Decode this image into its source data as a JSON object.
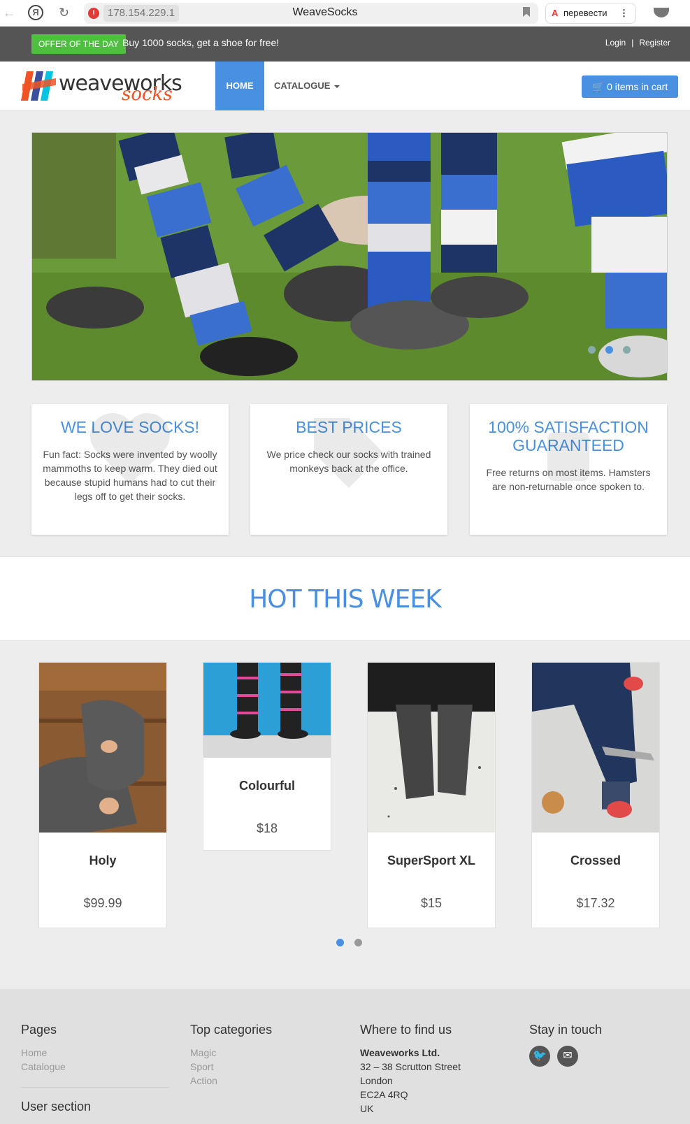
{
  "browser": {
    "address": "178.154.229.1",
    "tab_title": "WeaveSocks",
    "translate_label": "перевести"
  },
  "offer": {
    "badge": "OFFER OF THE DAY",
    "text": "Buy 1000 socks, get a shoe for free!",
    "login": "Login",
    "register": "Register"
  },
  "nav": {
    "logo_word1": "weaveworks",
    "logo_word2": "socks",
    "home": "HOME",
    "catalogue": "CATALOGUE",
    "cart": "0 items in cart"
  },
  "features": [
    {
      "title": "WE LOVE SOCKS!",
      "text": "Fun fact: Socks were invented by woolly mammoths to keep warm. They died out because stupid humans had to cut their legs off to get their socks."
    },
    {
      "title": "BEST PRICES",
      "text": "We price check our socks with trained monkeys back at the office."
    },
    {
      "title": "100% SATISFACTION GUARANTEED",
      "text": "Free returns on most items. Hamsters are non-returnable once spoken to."
    }
  ],
  "hot": {
    "title": "HOT THIS WEEK",
    "products": [
      {
        "name": "Holy",
        "price": "$99.99"
      },
      {
        "name": "Colourful",
        "price": "$18"
      },
      {
        "name": "SuperSport XL",
        "price": "$15"
      },
      {
        "name": "Crossed",
        "price": "$17.32"
      }
    ]
  },
  "footer": {
    "pages_title": "Pages",
    "pages": [
      "Home",
      "Catalogue"
    ],
    "user_section": "User section",
    "categories_title": "Top categories",
    "categories": [
      "Magic",
      "Sport",
      "Action"
    ],
    "find_title": "Where to find us",
    "address": [
      "Weaveworks Ltd.",
      "32 – 38 Scrutton Street",
      "London",
      "EC2A 4RQ",
      "UK"
    ],
    "touch_title": "Stay in touch"
  },
  "colors": {
    "accent": "#4a90e2",
    "offer_green": "#4fbf40",
    "brand_orange": "#f05323"
  }
}
